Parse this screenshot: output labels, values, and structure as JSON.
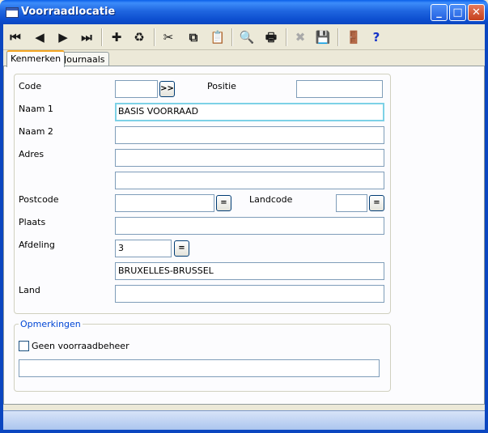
{
  "window": {
    "title": "Voorraadlocatie",
    "buttons": {
      "minimize": "_",
      "maximize": "□",
      "close": "✕"
    }
  },
  "toolbar": {
    "first_icon": "⏮",
    "prev_icon": "◀",
    "next_icon": "▶",
    "last_icon": "⏭",
    "add_icon": "✚",
    "recycle_icon": "♻",
    "cut_icon": "✂",
    "copy_icon": "⧉",
    "paste_icon": "📋",
    "search_icon": "🔍",
    "print_icon": "🖶",
    "delete_icon": "✖",
    "save_icon": "💾",
    "exit_icon": "🚪",
    "help_icon": "?"
  },
  "tabs": [
    {
      "label": "Kenmerken"
    },
    {
      "label": "Journaals"
    }
  ],
  "form": {
    "code_label": "Code",
    "code_value": "",
    "code_lookup": ">>",
    "positie_label": "Positie",
    "positie_value": "",
    "naam1_label": "Naam 1",
    "naam1_value": "BASIS VOORRAAD",
    "naam2_label": "Naam 2",
    "naam2_value": "",
    "adres_label": "Adres",
    "adres1_value": "",
    "adres2_value": "",
    "postcode_label": "Postcode",
    "postcode_value": "",
    "lookup_symbol": "=",
    "landcode_label": "Landcode",
    "landcode_value": "",
    "plaats_label": "Plaats",
    "plaats_value": "",
    "afdeling_label": "Afdeling",
    "afdeling_value": "3",
    "afdeling_name": "BRUXELLES-BRUSSEL",
    "land_label": "Land",
    "land_value": ""
  },
  "remarks": {
    "title": "Opmerkingen",
    "checkbox_label": "Geen voorraadbeheer",
    "checkbox_checked": false,
    "text_value": ""
  }
}
